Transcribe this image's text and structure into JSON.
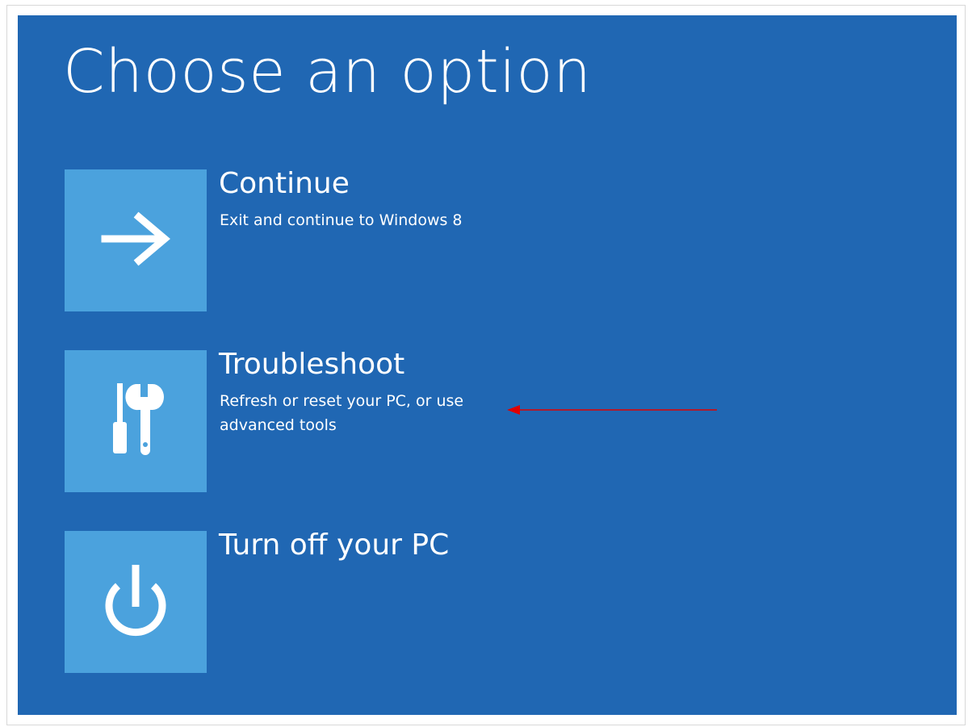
{
  "title": "Choose an option",
  "options": [
    {
      "title": "Continue",
      "description": "Exit and continue to Windows 8",
      "icon": "arrow-right-icon"
    },
    {
      "title": "Troubleshoot",
      "description": "Refresh or reset your PC, or use advanced tools",
      "icon": "tools-icon"
    },
    {
      "title": "Turn off your PC",
      "description": "",
      "icon": "power-icon"
    }
  ],
  "colors": {
    "background": "#2067b3",
    "tile": "#4ba2dd",
    "text": "#ffffff",
    "annotation_arrow": "#e00000"
  }
}
